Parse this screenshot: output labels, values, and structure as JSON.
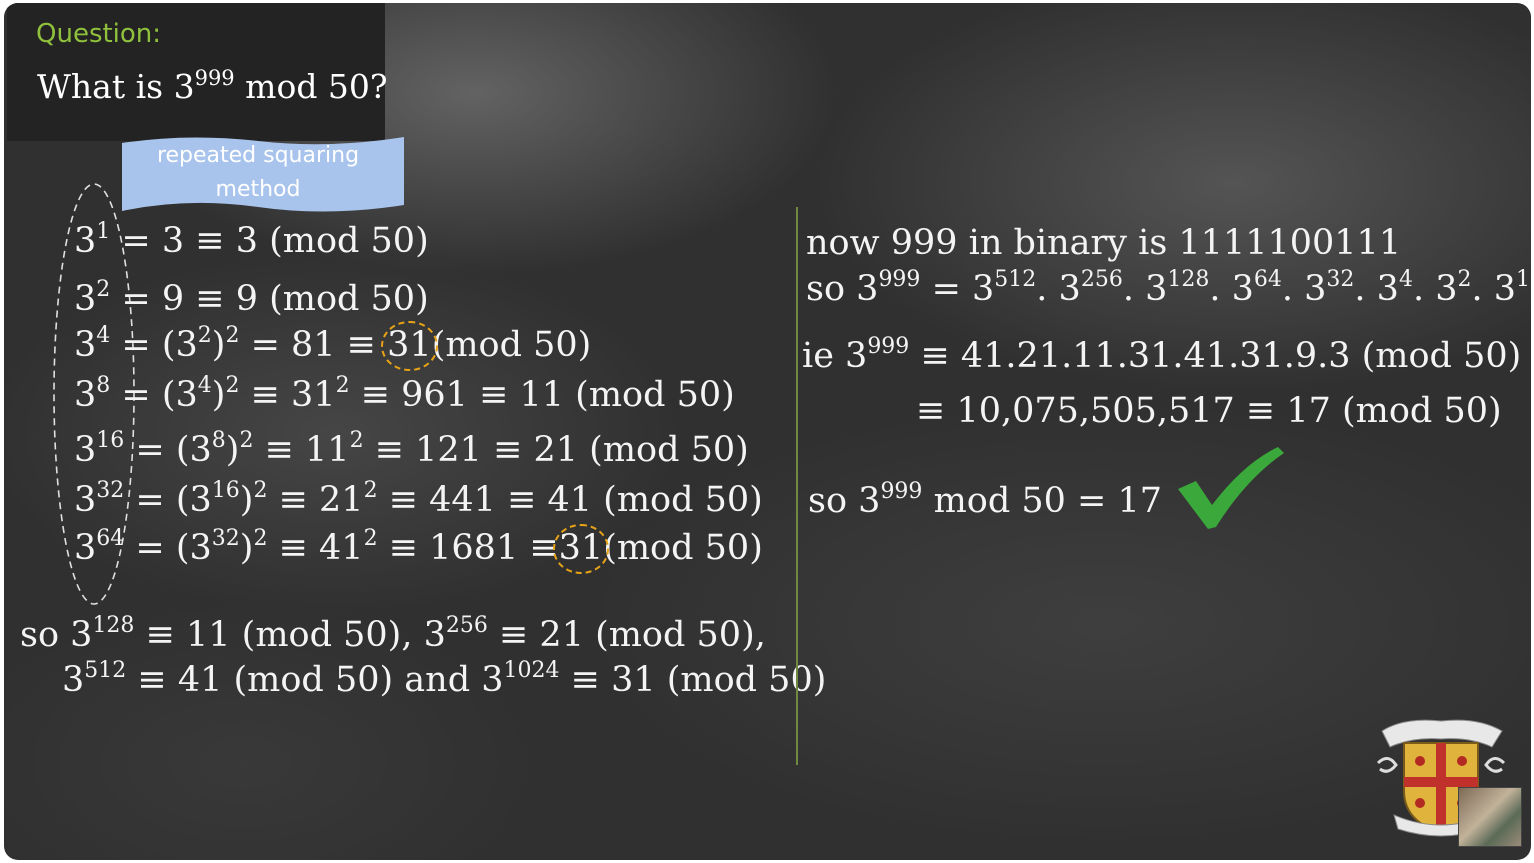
{
  "question": {
    "label": "Question:",
    "prefix": "What is 3",
    "exp": "999",
    "suffix": " mod 50?"
  },
  "method_label": "repeated squaring method",
  "left_lines": [
    {
      "base": "3",
      "exp": "1",
      "rest": " = 3 ≡ 3 (mod 50)"
    },
    {
      "base": "3",
      "exp": "2",
      "rest": " = 9 ≡ 9 (mod 50)"
    },
    {
      "base": "3",
      "exp": "4",
      "mid": " = (3",
      "e2": "2",
      "mid2": ")",
      "e3": "2",
      "mid3": " = 81 ≡ ",
      "circled": "31",
      "tail": "(mod 50)"
    },
    {
      "base": "3",
      "exp": "8",
      "mid": " = (3",
      "e2": "4",
      "mid2": ")",
      "e3": "2",
      "mid3": " ≡ 31",
      "e4": "2",
      "tail": " ≡  961 ≡ 11 (mod 50)"
    },
    {
      "base": "3",
      "exp": "16",
      "mid": " = (3",
      "e2": "8",
      "mid2": ")",
      "e3": "2",
      "mid3": " ≡ 11",
      "e4": "2",
      "tail": " ≡  121 ≡ 21 (mod 50)"
    },
    {
      "base": "3",
      "exp": "32",
      "mid": " = (3",
      "e2": "16",
      "mid2": ")",
      "e3": "2",
      "mid3": " ≡ 21",
      "e4": "2",
      "tail": " ≡  441 ≡ 41 (mod 50)"
    },
    {
      "base": "3",
      "exp": "64",
      "mid": " = (3",
      "e2": "32",
      "mid2": ")",
      "e3": "2",
      "mid3": " ≡ 41",
      "e4": "2",
      "mid4": " ≡  1681 ≡",
      "circled": "31",
      "tail": "(mod 50)"
    }
  ],
  "so_lines": {
    "l1_a": "so 3",
    "l1_e1": "128",
    "l1_b": " ≡ 11 (mod 50), 3",
    "l1_e2": "256",
    "l1_c": " ≡ 21 (mod 50),",
    "l2_a": "3",
    "l2_e1": "512",
    "l2_b": " ≡ 41 (mod 50) and 3",
    "l2_e2": "1024",
    "l2_c": " ≡ 31 (mod 50)"
  },
  "right": {
    "binary_line": "now 999 in binary is 1111100111",
    "so_prefix": "so 3",
    "so_exp": "999",
    "so_eq": " =  3",
    "factors": [
      "512",
      "256",
      "128",
      "64",
      "32",
      "4",
      "2",
      "1"
    ],
    "ie_prefix": "ie 3",
    "ie_exp": "999",
    "ie_rest": " ≡ 41.21.11.31.41.31.9.3 (mod 50)",
    "result_line": "≡ 10,075,505,517 ≡ 17 (mod 50)",
    "final_prefix": "so 3",
    "final_exp": "999",
    "final_rest": " mod 50 = 17"
  },
  "colors": {
    "accent_green": "#8fc13c",
    "circle_orange": "#e8a317",
    "banner_blue": "#a9c4ec",
    "check_green": "#3aa83a"
  }
}
